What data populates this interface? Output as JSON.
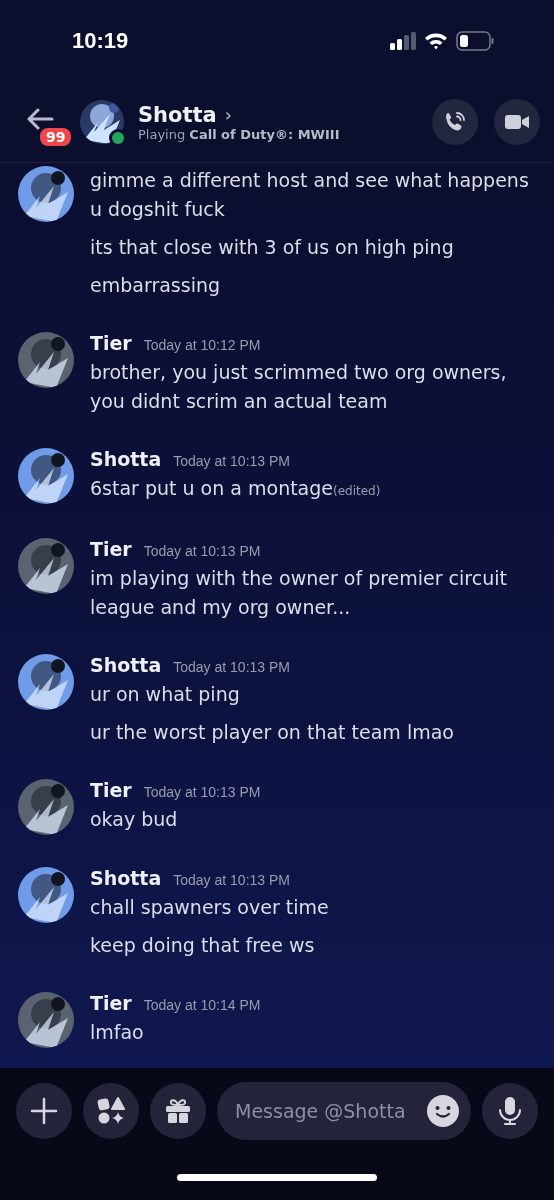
{
  "status_bar": {
    "time": "10:19"
  },
  "header": {
    "back_badge": "99",
    "name": "Shotta",
    "chevron": "›",
    "activity_prefix": "Playing ",
    "activity_game": "Call of Duty®: MWIII",
    "online": true
  },
  "messages": [
    {
      "color": "#6f9be8",
      "lines": [
        {
          "text": "gimme a different host and see what happens u dogshit fuck"
        },
        {
          "text": "its that close with 3 of us on high ping"
        },
        {
          "text": "embarrassing"
        }
      ]
    },
    {
      "author": "Tier",
      "time": "Today at 10:12 PM",
      "color": "#5b6270",
      "lines": [
        {
          "text": "brother, you just scrimmed two org owners, you didnt scrim an actual team"
        }
      ]
    },
    {
      "author": "Shotta",
      "time": "Today at 10:13 PM",
      "color": "#6f9be8",
      "lines": [
        {
          "text": "6star put u on a montage",
          "edited_label": "(edited)"
        }
      ]
    },
    {
      "author": "Tier",
      "time": "Today at 10:13 PM",
      "color": "#5b6270",
      "lines": [
        {
          "text": "im playing with the owner of premier circuit league and my org owner..."
        }
      ]
    },
    {
      "author": "Shotta",
      "time": "Today at 10:13 PM",
      "color": "#6f9be8",
      "lines": [
        {
          "text": "ur on what ping"
        },
        {
          "text": "ur the worst player on that team lmao"
        }
      ]
    },
    {
      "author": "Tier",
      "time": "Today at 10:13 PM",
      "color": "#5b6270",
      "lines": [
        {
          "text": "okay bud"
        }
      ]
    },
    {
      "author": "Shotta",
      "time": "Today at 10:13 PM",
      "color": "#6f9be8",
      "lines": [
        {
          "text": "chall spawners over time"
        },
        {
          "text": "keep doing that free ws"
        }
      ]
    },
    {
      "author": "Tier",
      "time": "Today at 10:14 PM",
      "color": "#5b6270",
      "lines": [
        {
          "text": "lmfao"
        }
      ]
    }
  ],
  "composer": {
    "placeholder": "Message @Shotta"
  }
}
